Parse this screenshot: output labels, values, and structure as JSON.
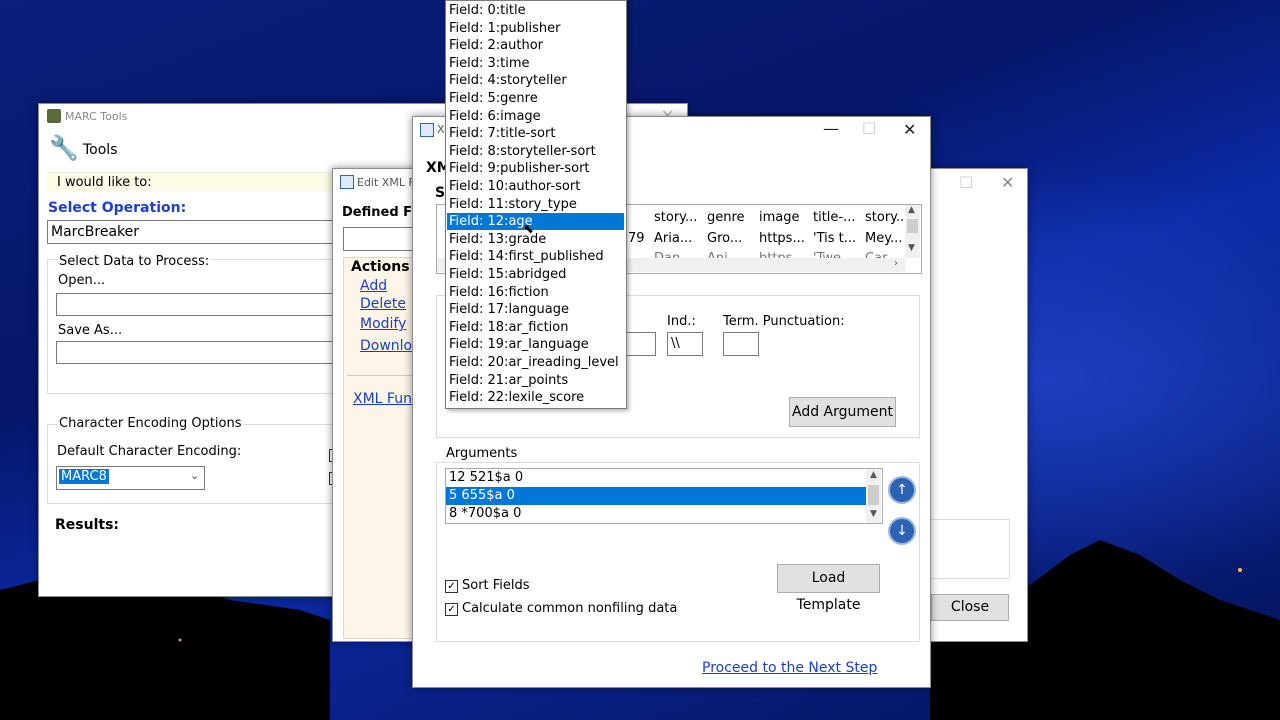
{
  "marc_tools": {
    "title": "MARC Tools",
    "toolbar_label": "Tools",
    "would_like": "I would like to:",
    "select_operation": "Select Operation:",
    "operation_value": "MarcBreaker",
    "select_data": "Select Data to Process:",
    "open_label": "Open...",
    "save_as_label": "Save As...",
    "encoding_group": "Character Encoding Options",
    "default_encoding": "Default Character Encoding:",
    "encoding_value": "MARC8",
    "results": "Results:"
  },
  "edit_xml": {
    "title": "Edit XML Fu",
    "defined_label": "Defined Fu",
    "actions": "Actions",
    "add": "Add",
    "delete": "Delete",
    "modify": "Modify",
    "download": "Downloa",
    "xml_func": "XML Func"
  },
  "back_window": {
    "close": "Close"
  },
  "xml_dialog": {
    "title_fragment": "X",
    "heading_fragment": "XM",
    "sub_fragment": "S",
    "grid_headers": [
      "story...",
      "genre",
      "image",
      "title-...",
      "story.."
    ],
    "grid_row": [
      "Aria...",
      "Gro...",
      "https...",
      "'Tis t...",
      "Mey..."
    ],
    "grid_row_partial": [
      "Dan",
      "Ani",
      "https",
      "'Twe",
      "Car"
    ],
    "grid_prefix": "79",
    "ind_label": "Ind.:",
    "ind_value": "\\\\",
    "term_punct": "Term. Punctuation:",
    "add_argument": "Add Argument",
    "arguments_label": "Arguments",
    "arguments": [
      "12  521$a  0",
      "5  655$a  0",
      "8  *700$a  0"
    ],
    "selected_argument": 1,
    "sort_fields": "Sort Fields",
    "calc_nonfiling": "Calculate common nonfiling data",
    "load_template": "Load Template",
    "proceed": "Proceed to the Next Step"
  },
  "dropdown": {
    "items": [
      "Field: 0:title",
      "Field: 1:publisher",
      "Field: 2:author",
      "Field: 3:time",
      "Field: 4:storyteller",
      "Field: 5:genre",
      "Field: 6:image",
      "Field: 7:title-sort",
      "Field: 8:storyteller-sort",
      "Field: 9:publisher-sort",
      "Field: 10:author-sort",
      "Field: 11:story_type",
      "Field: 12:age",
      "Field: 13:grade",
      "Field: 14:first_published",
      "Field: 15:abridged",
      "Field: 16:fiction",
      "Field: 17:language",
      "Field: 18:ar_fiction",
      "Field: 19:ar_language",
      "Field: 20:ar_ireading_level",
      "Field: 21:ar_points",
      "Field: 22:lexile_score"
    ],
    "selected_index": 12
  },
  "colors": {
    "accent": "#0078d7",
    "link": "#1a3ec9",
    "heading_blue": "#1d3fcf"
  }
}
